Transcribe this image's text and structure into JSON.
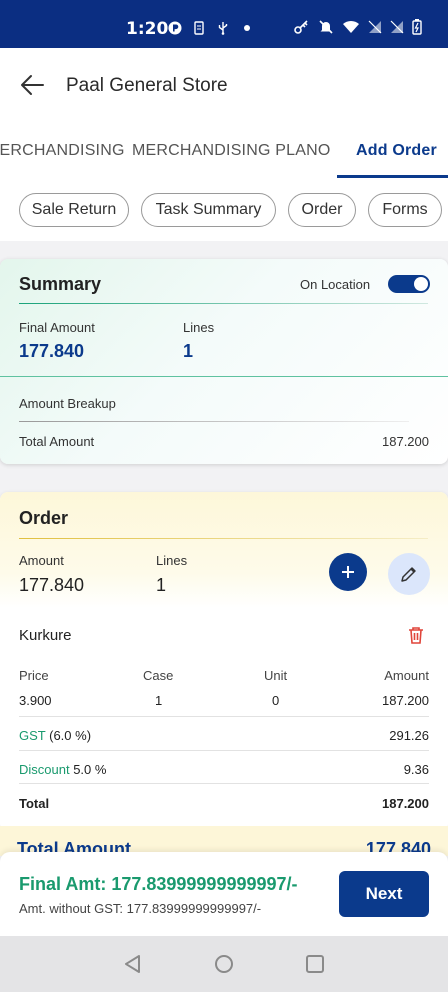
{
  "status_bar": {
    "time": "1:20",
    "icons": [
      "app-icon",
      "phone-icon",
      "usb-icon",
      "dot-icon",
      "vpn-key-icon",
      "mute-icon",
      "wifi-icon",
      "signal-icon",
      "signal-icon",
      "battery-icon"
    ]
  },
  "header": {
    "title": "Paal General Store"
  },
  "tabs": [
    {
      "label": "MERCHANDISING",
      "active": false
    },
    {
      "label": "MERCHANDISING PLANO",
      "active": false
    },
    {
      "label": "Add Order",
      "active": true
    }
  ],
  "chips": [
    "Sale Return",
    "Task Summary",
    "Order",
    "Forms"
  ],
  "summary": {
    "title": "Summary",
    "on_location_label": "On Location",
    "on_location": true,
    "final_amount_label": "Final Amount",
    "final_amount": "177.840",
    "lines_label": "Lines",
    "lines": "1",
    "amount_breakup_label": "Amount Breakup",
    "total_amount_label": "Total Amount",
    "total_amount": "187.200"
  },
  "order": {
    "title": "Order",
    "amount_label": "Amount",
    "amount": "177.840",
    "lines_label": "Lines",
    "lines": "1",
    "item": {
      "name": "Kurkure",
      "columns": [
        "Price",
        "Case",
        "Unit",
        "Amount"
      ],
      "price": "3.900",
      "case": "1",
      "unit": "0",
      "amount": "187.200",
      "gst_label": "GST",
      "gst_rate": "(6.0 %)",
      "gst_value": "291.26",
      "discount_label": "Discount",
      "discount_rate": "5.0 %",
      "discount_value": "9.36",
      "total_label": "Total",
      "total_value": "187.200"
    }
  },
  "total_peek": {
    "label": "Total Amount",
    "value": "177.840"
  },
  "bottom": {
    "final_amt": "Final Amt: 177.83999999999997/-",
    "amt_without_gst": "Amt. without GST: 177.83999999999997/-",
    "next_label": "Next"
  },
  "colors": {
    "primary": "#0b3a8c",
    "status_bar": "#0b2e82",
    "green": "#1a9a6e",
    "danger": "#e0453a"
  }
}
